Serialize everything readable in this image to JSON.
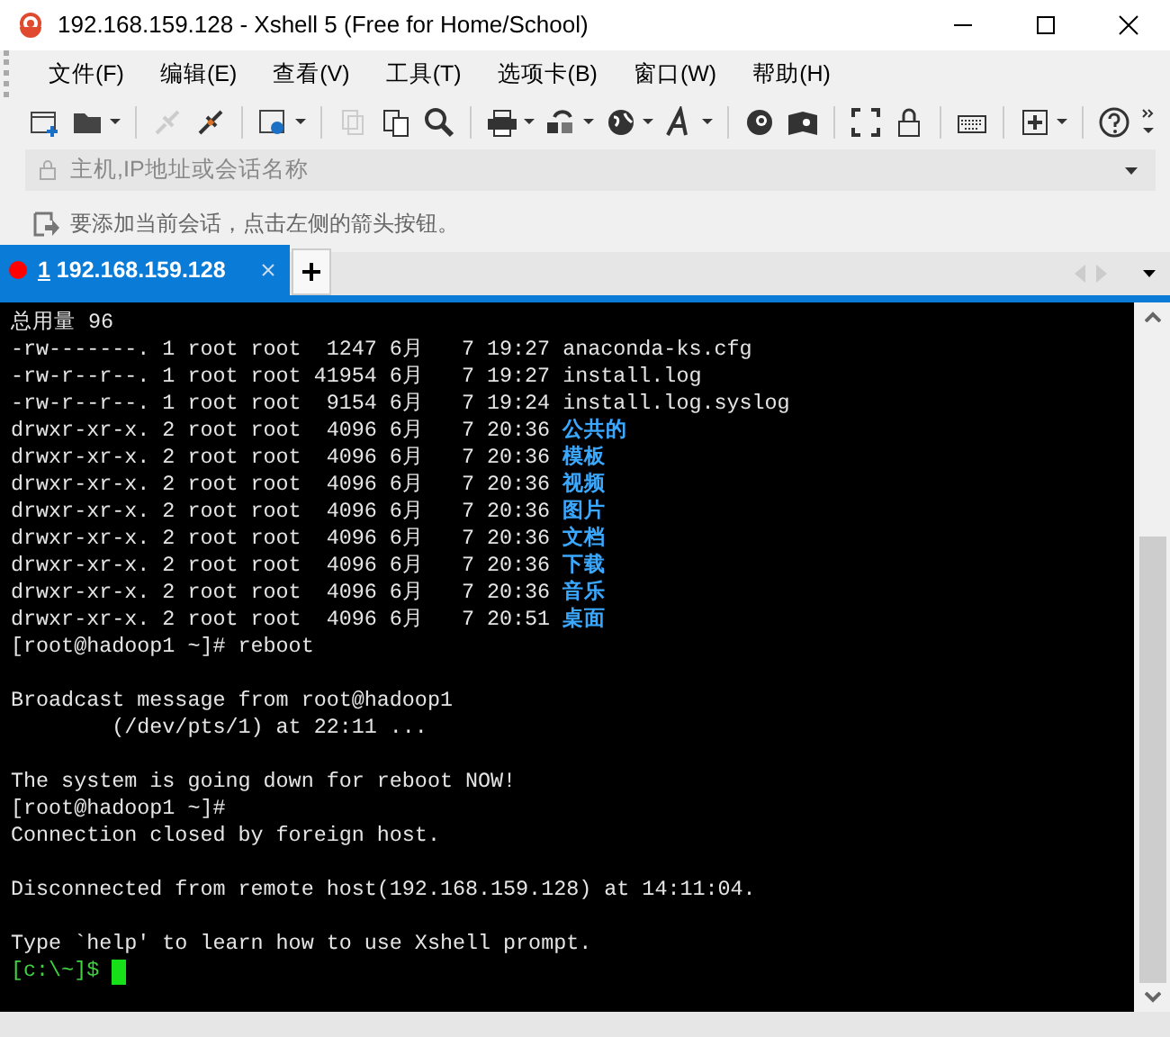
{
  "window": {
    "title": "192.168.159.128 - Xshell 5 (Free for Home/School)"
  },
  "menu": [
    "文件(F)",
    "编辑(E)",
    "查看(V)",
    "工具(T)",
    "选项卡(B)",
    "窗口(W)",
    "帮助(H)"
  ],
  "address_bar": {
    "placeholder": "主机,IP地址或会话名称"
  },
  "hint_bar": {
    "text": "要添加当前会话，点击左侧的箭头按钮。"
  },
  "tabs": [
    {
      "number": "1",
      "label": "192.168.159.128",
      "selected": true,
      "connected": false
    }
  ],
  "terminal": {
    "lines": [
      {
        "kind": "plain",
        "text": "总用量 96"
      },
      {
        "kind": "entry",
        "info": "-rw-------. 1 root root  1247 6月   7 19:27",
        "name": "anaconda-ks.cfg",
        "is_dir": false
      },
      {
        "kind": "entry",
        "info": "-rw-r--r--. 1 root root 41954 6月   7 19:27",
        "name": "install.log",
        "is_dir": false
      },
      {
        "kind": "entry",
        "info": "-rw-r--r--. 1 root root  9154 6月   7 19:24",
        "name": "install.log.syslog",
        "is_dir": false
      },
      {
        "kind": "entry",
        "info": "drwxr-xr-x. 2 root root  4096 6月   7 20:36",
        "name": "公共的",
        "is_dir": true
      },
      {
        "kind": "entry",
        "info": "drwxr-xr-x. 2 root root  4096 6月   7 20:36",
        "name": "模板",
        "is_dir": true
      },
      {
        "kind": "entry",
        "info": "drwxr-xr-x. 2 root root  4096 6月   7 20:36",
        "name": "视频",
        "is_dir": true
      },
      {
        "kind": "entry",
        "info": "drwxr-xr-x. 2 root root  4096 6月   7 20:36",
        "name": "图片",
        "is_dir": true
      },
      {
        "kind": "entry",
        "info": "drwxr-xr-x. 2 root root  4096 6月   7 20:36",
        "name": "文档",
        "is_dir": true
      },
      {
        "kind": "entry",
        "info": "drwxr-xr-x. 2 root root  4096 6月   7 20:36",
        "name": "下载",
        "is_dir": true
      },
      {
        "kind": "entry",
        "info": "drwxr-xr-x. 2 root root  4096 6月   7 20:36",
        "name": "音乐",
        "is_dir": true
      },
      {
        "kind": "entry",
        "info": "drwxr-xr-x. 2 root root  4096 6月   7 20:51",
        "name": "桌面",
        "is_dir": true
      },
      {
        "kind": "plain",
        "text": "[root@hadoop1 ~]# reboot"
      },
      {
        "kind": "blank"
      },
      {
        "kind": "plain",
        "text": "Broadcast message from root@hadoop1"
      },
      {
        "kind": "plain",
        "text": "        (/dev/pts/1) at 22:11 ..."
      },
      {
        "kind": "blank"
      },
      {
        "kind": "plain",
        "text": "The system is going down for reboot NOW!"
      },
      {
        "kind": "plain",
        "text": "[root@hadoop1 ~]#"
      },
      {
        "kind": "plain",
        "text": "Connection closed by foreign host."
      },
      {
        "kind": "blank"
      },
      {
        "kind": "plain",
        "text": "Disconnected from remote host(192.168.159.128) at 14:11:04."
      },
      {
        "kind": "blank"
      },
      {
        "kind": "plain",
        "text": "Type `help' to learn how to use Xshell prompt."
      },
      {
        "kind": "prompt",
        "text": "[c:\\~]$"
      }
    ]
  }
}
